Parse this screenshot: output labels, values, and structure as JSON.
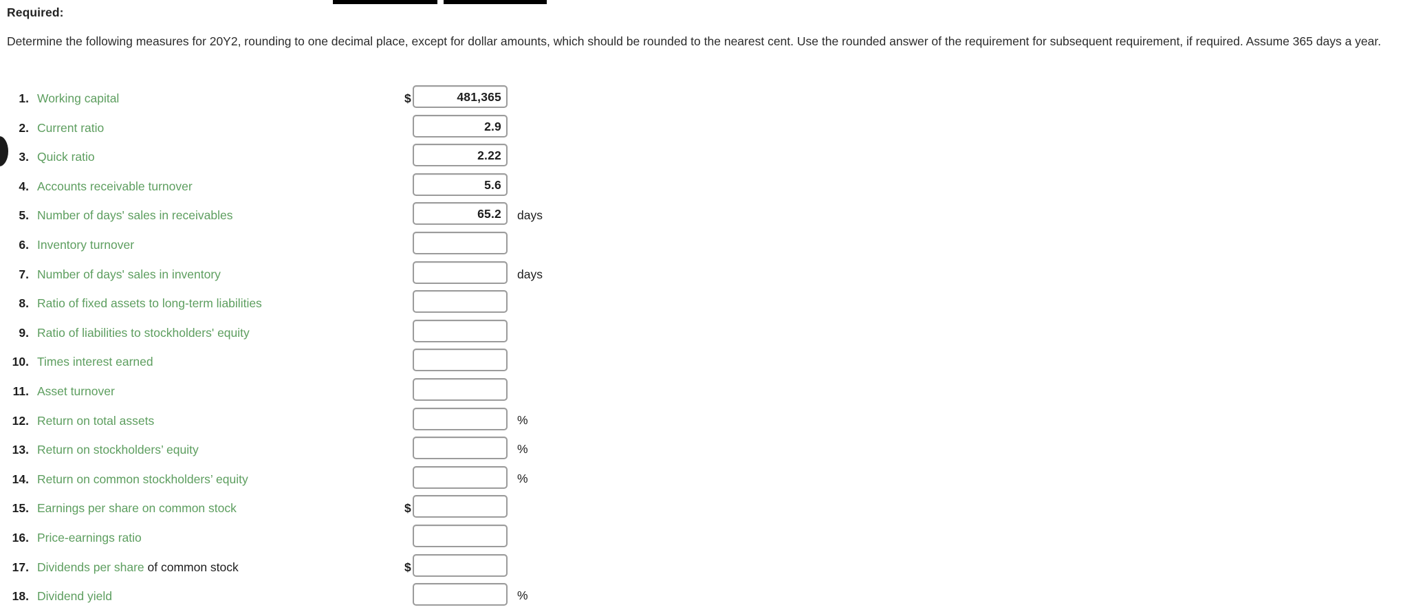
{
  "heading": "Required:",
  "instructions": "Determine the following measures for 20Y2, rounding to one decimal place, except for dollar amounts, which should be rounded to the nearest cent. Use the rounded answer of the requirement for subsequent requirement, if required. Assume 365 days a year.",
  "colors": {
    "label_green": "#5d9e5f",
    "text_black": "#1d1d1d",
    "box_border": "#9b9b9b",
    "redaction_bar": "#000000"
  },
  "top_bars": [
    {
      "name": "redaction-bar-1"
    },
    {
      "name": "redaction-bar-2"
    }
  ],
  "measures": [
    {
      "num": "1.",
      "label": "Working capital",
      "label_plain": "",
      "prefix": "$",
      "value": "481,365",
      "suffix": ""
    },
    {
      "num": "2.",
      "label": "Current ratio",
      "label_plain": "",
      "prefix": "",
      "value": "2.9",
      "suffix": ""
    },
    {
      "num": "3.",
      "label": "Quick ratio",
      "label_plain": "",
      "prefix": "",
      "value": "2.22",
      "suffix": ""
    },
    {
      "num": "4.",
      "label": "Accounts receivable turnover",
      "label_plain": "",
      "prefix": "",
      "value": "5.6",
      "suffix": ""
    },
    {
      "num": "5.",
      "label": "Number of days' sales in receivables",
      "label_plain": "",
      "prefix": "",
      "value": "65.2",
      "suffix": "days"
    },
    {
      "num": "6.",
      "label": "Inventory turnover",
      "label_plain": "",
      "prefix": "",
      "value": "",
      "suffix": ""
    },
    {
      "num": "7.",
      "label": "Number of days' sales in inventory",
      "label_plain": "",
      "prefix": "",
      "value": "",
      "suffix": "days"
    },
    {
      "num": "8.",
      "label": "Ratio of fixed assets to long-term liabilities",
      "label_plain": "",
      "prefix": "",
      "value": "",
      "suffix": ""
    },
    {
      "num": "9.",
      "label": "Ratio of liabilities to stockholders' equity",
      "label_plain": "",
      "prefix": "",
      "value": "",
      "suffix": ""
    },
    {
      "num": "10.",
      "label": "Times interest earned",
      "label_plain": "",
      "prefix": "",
      "value": "",
      "suffix": ""
    },
    {
      "num": "11.",
      "label": "Asset turnover",
      "label_plain": "",
      "prefix": "",
      "value": "",
      "suffix": ""
    },
    {
      "num": "12.",
      "label": "Return on total assets",
      "label_plain": "",
      "prefix": "",
      "value": "",
      "suffix": "%"
    },
    {
      "num": "13.",
      "label": "Return on stockholders’ equity",
      "label_plain": "",
      "prefix": "",
      "value": "",
      "suffix": "%"
    },
    {
      "num": "14.",
      "label": "Return on common stockholders’ equity",
      "label_plain": "",
      "prefix": "",
      "value": "",
      "suffix": "%"
    },
    {
      "num": "15.",
      "label": "Earnings per share on common stock",
      "label_plain": "",
      "prefix": "$",
      "value": "",
      "suffix": ""
    },
    {
      "num": "16.",
      "label": "Price-earnings ratio",
      "label_plain": "",
      "prefix": "",
      "value": "",
      "suffix": ""
    },
    {
      "num": "17.",
      "label": "Dividends per share",
      "label_plain": " of common stock",
      "prefix": "$",
      "value": "",
      "suffix": ""
    },
    {
      "num": "18.",
      "label": "Dividend yield",
      "label_plain": "",
      "prefix": "",
      "value": "",
      "suffix": "%"
    }
  ]
}
